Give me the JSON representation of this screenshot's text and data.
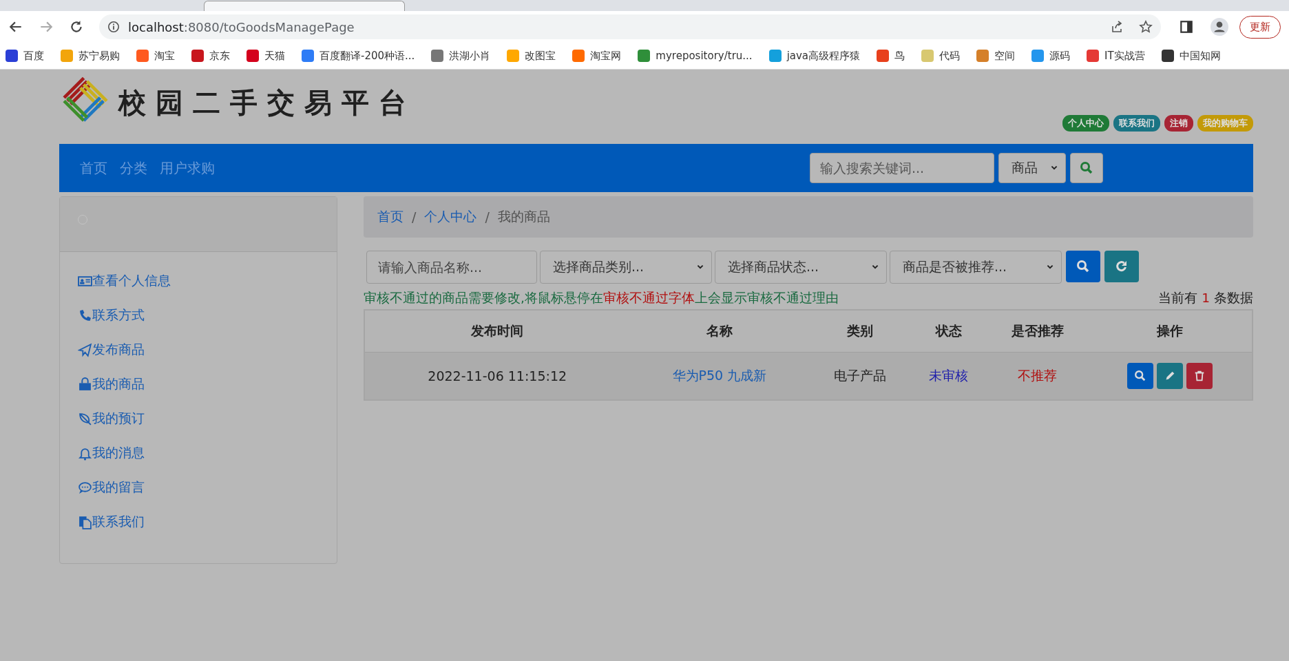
{
  "browser": {
    "address_host": "localhost",
    "address_rest": ":8080/toGoodsManagePage",
    "update_button": "更新",
    "bookmarks": [
      {
        "label": "百度",
        "color": "#2b3fd6"
      },
      {
        "label": "苏宁易购",
        "color": "#f2a50c"
      },
      {
        "label": "淘宝",
        "color": "#ff5a1f"
      },
      {
        "label": "京东",
        "color": "#c8161d"
      },
      {
        "label": "天猫",
        "color": "#d4001c"
      },
      {
        "label": "百度翻译-200种语...",
        "color": "#2e7cf6"
      },
      {
        "label": "洪湖小肖",
        "color": "#777777"
      },
      {
        "label": "改图宝",
        "color": "#ffa800"
      },
      {
        "label": "淘宝网",
        "color": "#ff6a00"
      },
      {
        "label": "myrepository/tru...",
        "color": "#2f8f3a"
      },
      {
        "label": "java高级程序猿",
        "color": "#14a0dc"
      },
      {
        "label": "鸟",
        "color": "#e8401c"
      },
      {
        "label": "代码",
        "color": "#d8c870"
      },
      {
        "label": "空间",
        "color": "#d5802a"
      },
      {
        "label": "源码",
        "color": "#2496ed"
      },
      {
        "label": "IT实战营",
        "color": "#e53935"
      },
      {
        "label": "中国知网",
        "color": "#333333"
      }
    ]
  },
  "header": {
    "site_title": "校园二手交易平台",
    "badges": [
      {
        "label": "个人中心",
        "color": "#1f7a37"
      },
      {
        "label": "联系我们",
        "color": "#1a7484"
      },
      {
        "label": "注销",
        "color": "#a72434"
      },
      {
        "label": "我的购物车",
        "color": "#c39a08"
      }
    ]
  },
  "nav": {
    "links": [
      "首页",
      "分类",
      "用户求购"
    ],
    "search": {
      "placeholder": "输入搜索关键词..."
    },
    "scope_select": "商品"
  },
  "sidebar": {
    "items": [
      "查看个人信息",
      "联系方式",
      "发布商品",
      "我的商品",
      "我的预订",
      "我的消息",
      "我的留言",
      "联系我们"
    ]
  },
  "breadcrumb_separator": "/",
  "breadcrumb": [
    {
      "label": "首页",
      "active": false
    },
    {
      "label": "个人中心",
      "active": false
    },
    {
      "label": "我的商品",
      "active": true
    }
  ],
  "filters": {
    "name": {
      "placeholder": "请输入商品名称..."
    },
    "selects": [
      "选择商品类别...",
      "选择商品状态...",
      "商品是否被推荐..."
    ]
  },
  "notice": {
    "before": "审核不通过的商品需要修改,将鼠标悬停在",
    "highlight": "审核不通过字体",
    "after": "上会显示审核不通过理由"
  },
  "count": {
    "prefix": "当前有",
    "value": "1",
    "suffix": "条数据"
  },
  "table": {
    "columns": [
      "发布时间",
      "名称",
      "类别",
      "状态",
      "是否推荐",
      "操作"
    ],
    "rows": [
      {
        "time": "2022-11-06 11:15:12",
        "name": "华为P50 九成新",
        "category": "电子产品",
        "status": "未审核",
        "recommended": "不推荐"
      }
    ]
  }
}
